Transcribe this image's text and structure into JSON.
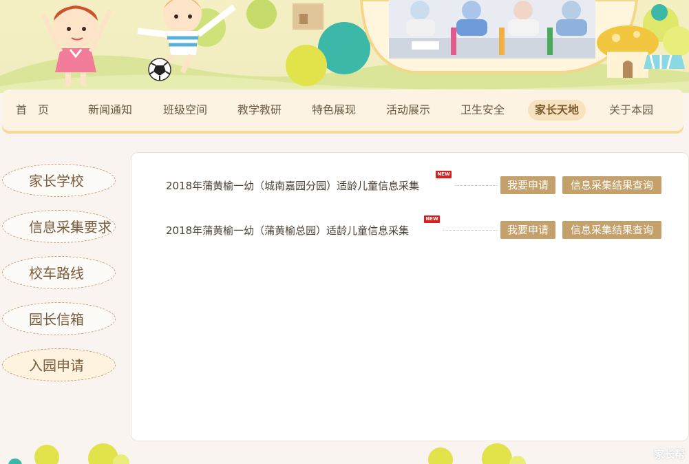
{
  "nav": {
    "items": [
      {
        "label": "首　页"
      },
      {
        "label": "新闻通知"
      },
      {
        "label": "班级空间"
      },
      {
        "label": "教学教研"
      },
      {
        "label": "特色展现"
      },
      {
        "label": "活动展示"
      },
      {
        "label": "卫生安全"
      },
      {
        "label": "家长天地"
      },
      {
        "label": "关于本园"
      }
    ],
    "active_index": 7
  },
  "sidebar": {
    "items": [
      {
        "label": "家长学校"
      },
      {
        "label": "信息采集要求"
      },
      {
        "label": "校车路线"
      },
      {
        "label": "园长信箱"
      },
      {
        "label": "入园申请"
      }
    ],
    "active_index": 4
  },
  "articles": [
    {
      "title": "2018年蒲黄榆一幼（城南嘉园分园）适龄儿童信息采集",
      "badge": "NEW"
    },
    {
      "title": "2018年蒲黄榆一幼（蒲黄榆总园）适龄儿童信息采集",
      "badge": "NEW"
    }
  ],
  "buttons": {
    "apply": "我要申请",
    "query": "信息采集结果查询"
  },
  "watermark": "家长帮",
  "colors": {
    "accent": "#c4a06a",
    "badge": "#d81e1e",
    "nav_bg": "#fdf3e2",
    "page_bg": "#f9f4f0"
  }
}
